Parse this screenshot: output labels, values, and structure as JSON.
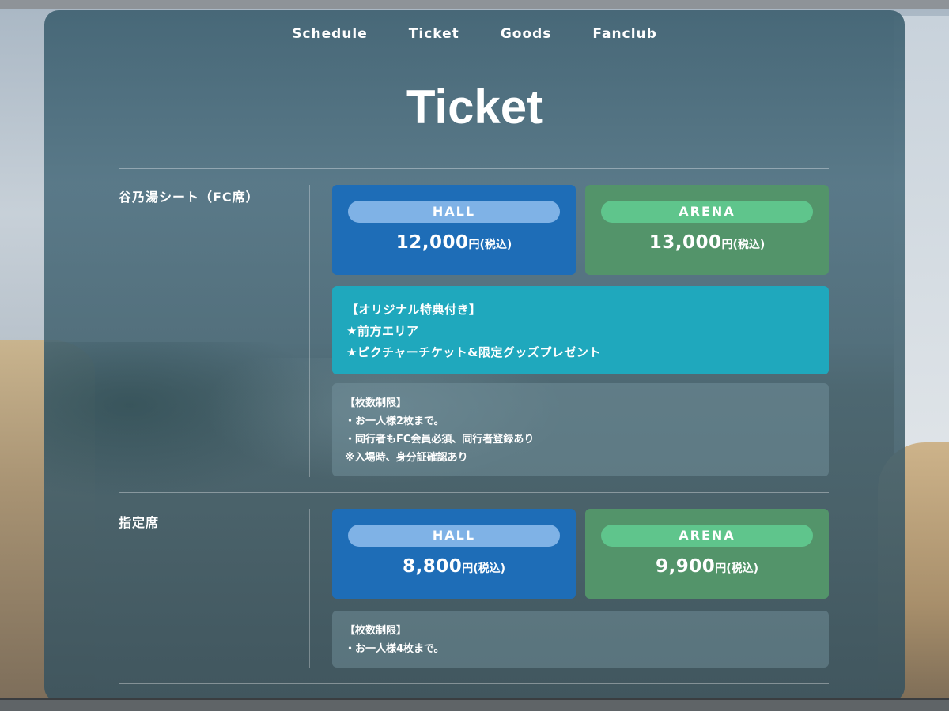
{
  "nav": {
    "items": [
      {
        "label": "Schedule"
      },
      {
        "label": "Ticket"
      },
      {
        "label": "Goods"
      },
      {
        "label": "Fanclub"
      }
    ]
  },
  "page": {
    "title": "Ticket"
  },
  "sections": [
    {
      "label": "谷乃湯シート（FC席）",
      "prices": {
        "hall": {
          "name": "HALL",
          "amount": "12,000",
          "unit": "円(税込)"
        },
        "arena": {
          "name": "ARENA",
          "amount": "13,000",
          "unit": "円(税込)"
        }
      },
      "bonus": {
        "lines": [
          "【オリジナル特典付き】",
          "★前方エリア",
          "★ピクチャーチケット&限定グッズプレゼント"
        ]
      },
      "limits": {
        "lines": [
          "【枚数制限】",
          "・お一人様2枚まで。",
          "・同行者もFC会員必須、同行者登録あり",
          "※入場時、身分証確認あり"
        ]
      }
    },
    {
      "label": "指定席",
      "prices": {
        "hall": {
          "name": "HALL",
          "amount": "8,800",
          "unit": "円(税込)"
        },
        "arena": {
          "name": "ARENA",
          "amount": "9,900",
          "unit": "円(税込)"
        }
      },
      "limits": {
        "lines": [
          "【枚数制限】",
          "・お一人様4枚まで。"
        ]
      }
    }
  ],
  "colors": {
    "hall": "#1e6db7",
    "hall_pill": "#7fb2e6",
    "arena": "#53946a",
    "arena_pill": "#5fc58c",
    "bonus": "#1fa8bd"
  }
}
